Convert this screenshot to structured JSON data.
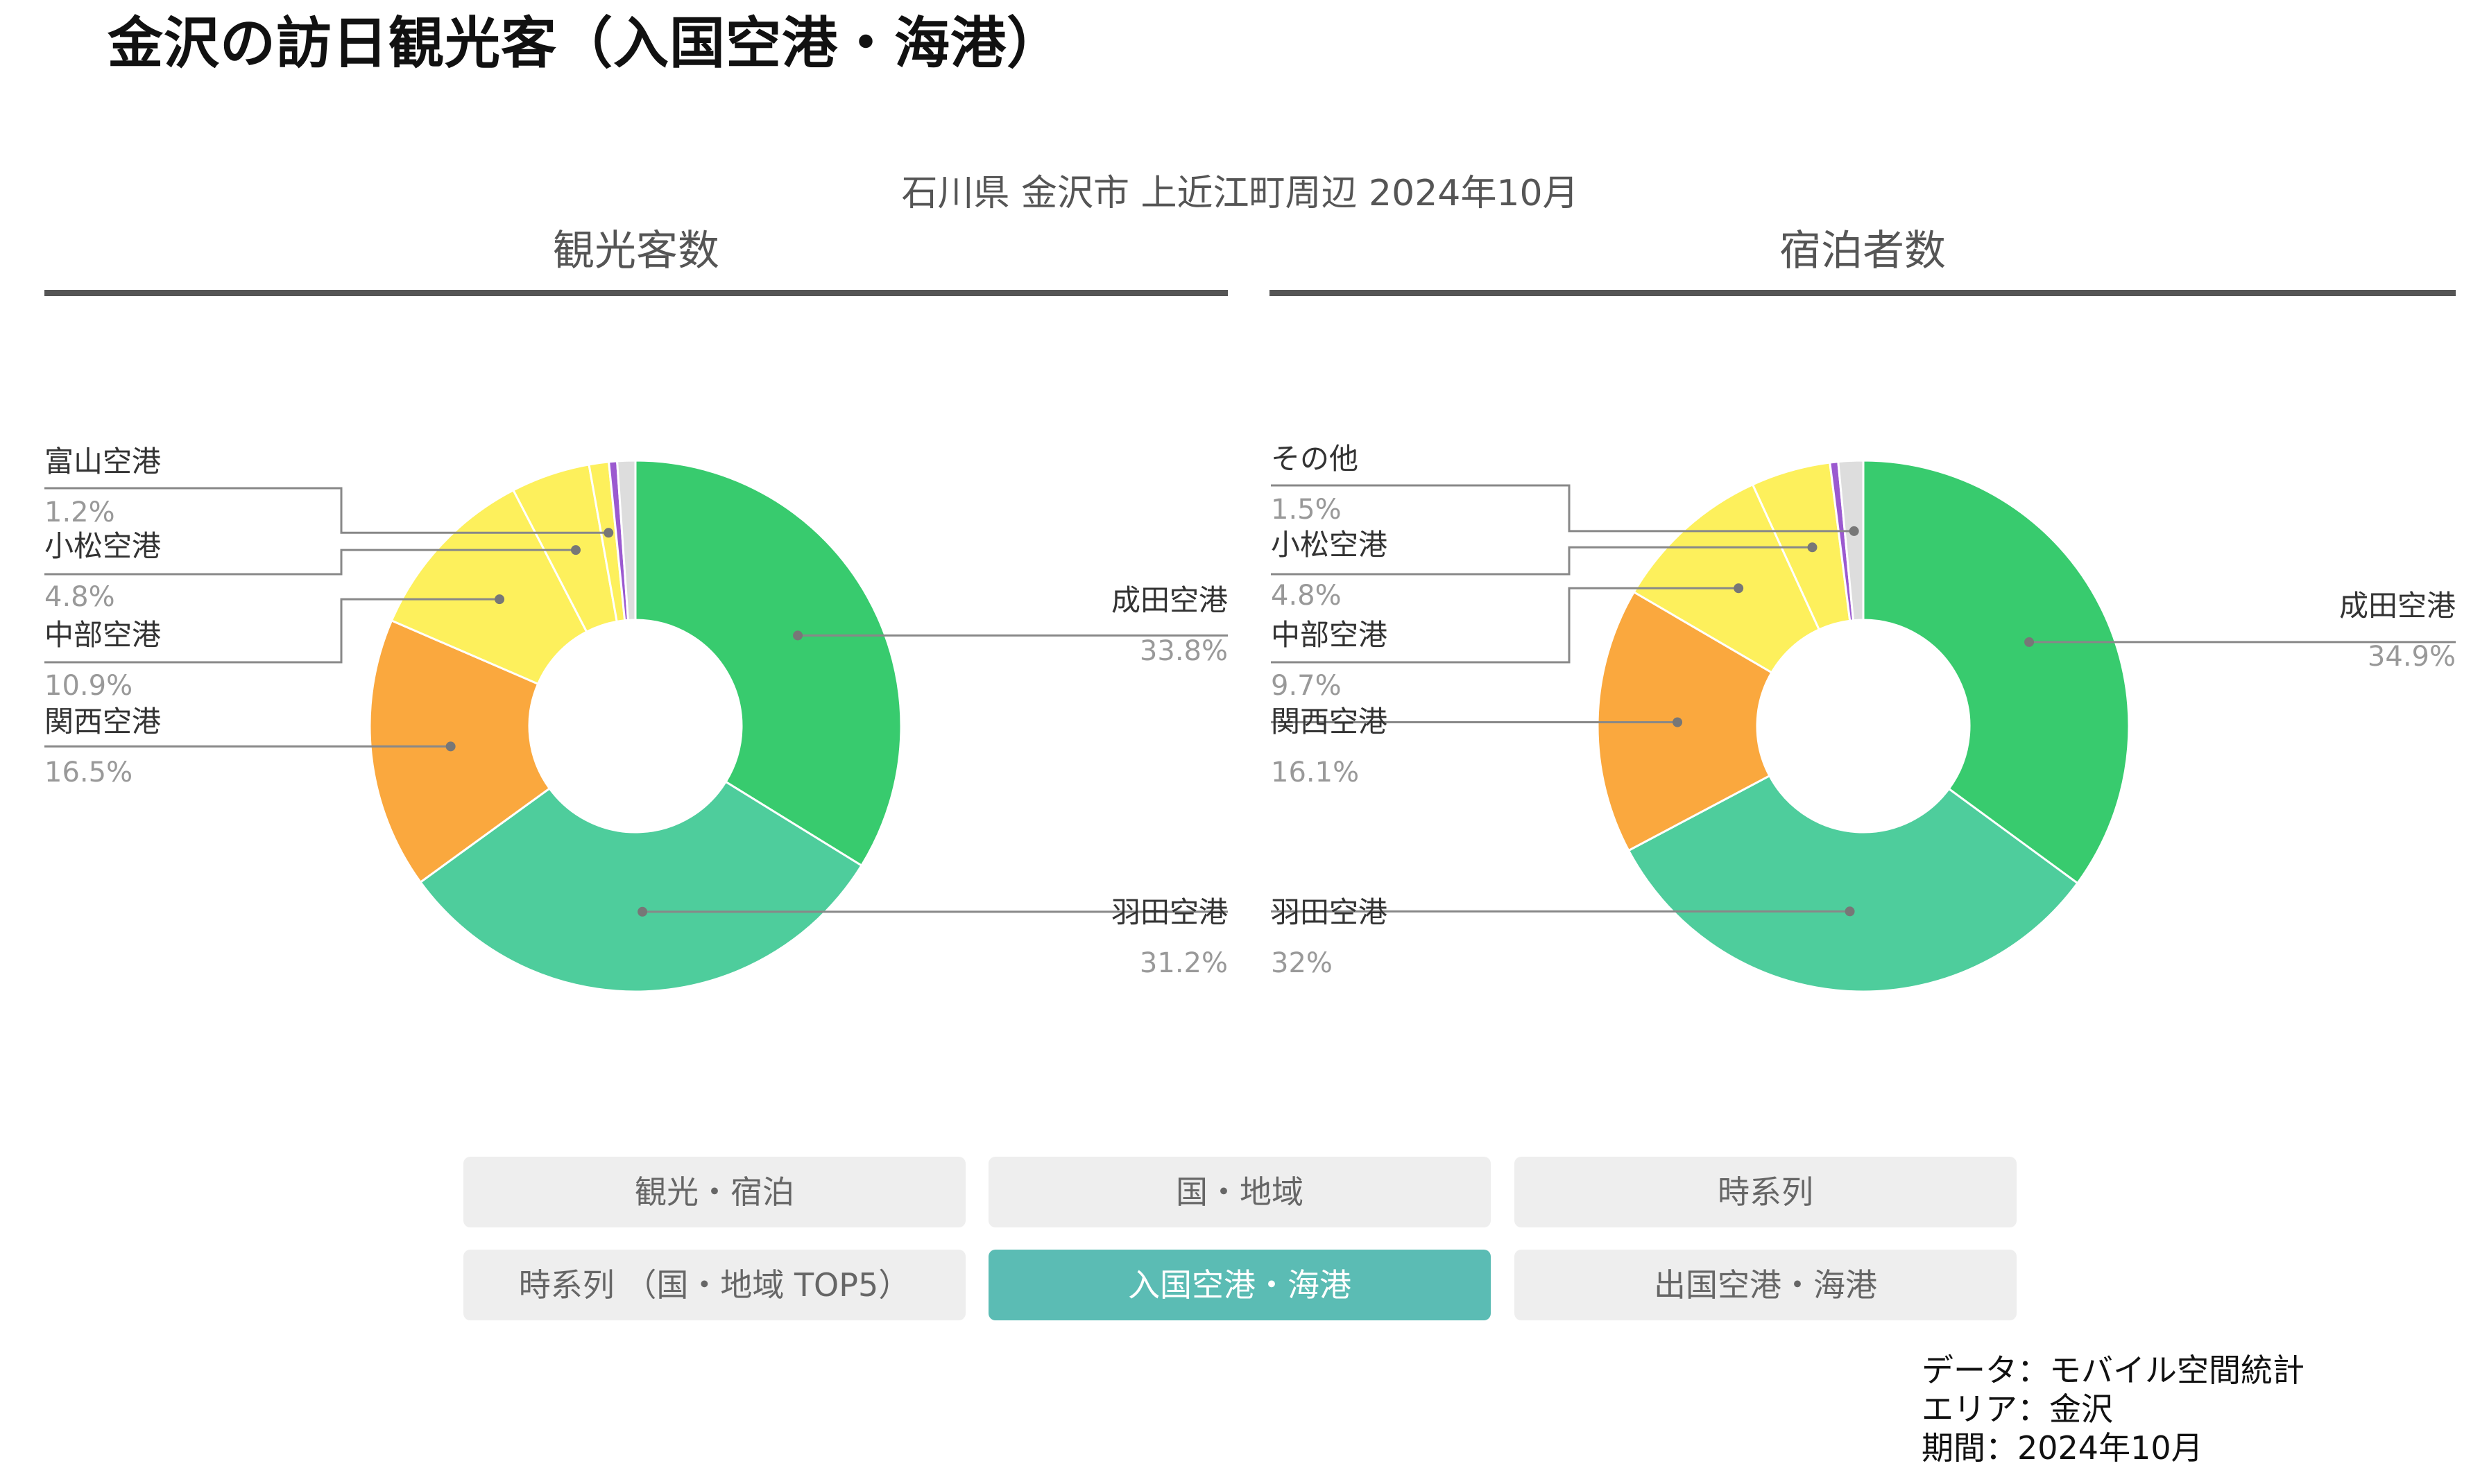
{
  "page_title": "金沢の訪日観光客（入国空港・海港）",
  "area_subtitle": "石川県 金沢市 上近江町周辺 2024年10月",
  "chart_data": [
    {
      "type": "pie",
      "title": "観光客数",
      "slices": [
        {
          "label": "成田空港",
          "display": "33.8%",
          "value": 33.8,
          "color": "#38cb6e"
        },
        {
          "label": "羽田空港",
          "display": "31.2%",
          "value": 31.2,
          "color": "#4ecd9c"
        },
        {
          "label": "関西空港",
          "display": "16.5%",
          "value": 16.5,
          "color": "#faa83e"
        },
        {
          "label": "中部空港",
          "display": "10.9%",
          "value": 10.9,
          "color": "#fdf05c"
        },
        {
          "label": "小松空港",
          "display": "4.8%",
          "value": 4.8,
          "color": "#fdf05c"
        },
        {
          "label": "富山空港",
          "display": "1.2%",
          "value": 1.2,
          "color": "#fdf05c"
        },
        {
          "label": "",
          "display": "",
          "value": 0.5,
          "color": "#9b59d0"
        },
        {
          "label": "",
          "display": "",
          "value": 1.1,
          "color": "#dddddd"
        }
      ]
    },
    {
      "type": "pie",
      "title": "宿泊者数",
      "slices": [
        {
          "label": "成田空港",
          "display": "34.9%",
          "value": 34.9,
          "color": "#38cb6e"
        },
        {
          "label": "羽田空港",
          "display": "32%",
          "value": 32.0,
          "color": "#4ecd9c"
        },
        {
          "label": "関西空港",
          "display": "16.1%",
          "value": 16.1,
          "color": "#faa83e"
        },
        {
          "label": "中部空港",
          "display": "9.7%",
          "value": 9.7,
          "color": "#fdf05c"
        },
        {
          "label": "小松空港",
          "display": "4.8%",
          "value": 4.8,
          "color": "#fdf05c"
        },
        {
          "label": "",
          "display": "",
          "value": 0.5,
          "color": "#9b59d0"
        },
        {
          "label": "その他",
          "display": "1.5%",
          "value": 1.5,
          "color": "#dddddd"
        }
      ]
    }
  ],
  "buttons": [
    {
      "label": "観光・宿泊",
      "active": false
    },
    {
      "label": "国・地域",
      "active": false
    },
    {
      "label": "時系列",
      "active": false
    },
    {
      "label": "時系列 （国・地域 TOP5）",
      "active": false
    },
    {
      "label": "入国空港・海港",
      "active": true
    },
    {
      "label": "出国空港・海港",
      "active": false
    }
  ],
  "source": {
    "data": "データ：モバイル空間統計",
    "area": "エリア：金沢",
    "period": "期間：2024年10月"
  }
}
